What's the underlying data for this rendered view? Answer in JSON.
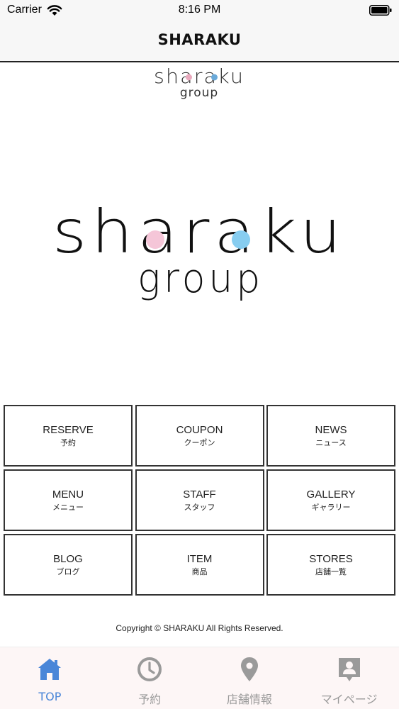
{
  "status_bar": {
    "carrier": "Carrier",
    "time": "8:16 PM"
  },
  "nav": {
    "title": "SHARAKU"
  },
  "logo": {
    "word": "sharaku",
    "sub": "group",
    "dot_pink": "#f5c6d8",
    "dot_blue": "#87cdf0",
    "small_dot_pink": "#e9a9bd",
    "small_dot_blue": "#6aa9d9"
  },
  "menu": [
    {
      "en": "RESERVE",
      "ja": "予約"
    },
    {
      "en": "COUPON",
      "ja": "クーポン"
    },
    {
      "en": "NEWS",
      "ja": "ニュース"
    },
    {
      "en": "MENU",
      "ja": "メニュー"
    },
    {
      "en": "STAFF",
      "ja": "スタッフ"
    },
    {
      "en": "GALLERY",
      "ja": "ギャラリー"
    },
    {
      "en": "BLOG",
      "ja": "ブログ"
    },
    {
      "en": "ITEM",
      "ja": "商品"
    },
    {
      "en": "STORES",
      "ja": "店舗一覧"
    }
  ],
  "footer": {
    "copyright": "Copyright © SHARAKU All Rights Reserved."
  },
  "tabs": [
    {
      "label": "TOP",
      "icon": "home-icon",
      "active": true
    },
    {
      "label": "予約",
      "icon": "clock-icon",
      "active": false
    },
    {
      "label": "店舗情報",
      "icon": "map-pin-icon",
      "active": false
    },
    {
      "label": "マイページ",
      "icon": "profile-icon",
      "active": false
    }
  ],
  "colors": {
    "active_tab": "#4a86d8",
    "inactive_tab": "#9a9a9a"
  }
}
